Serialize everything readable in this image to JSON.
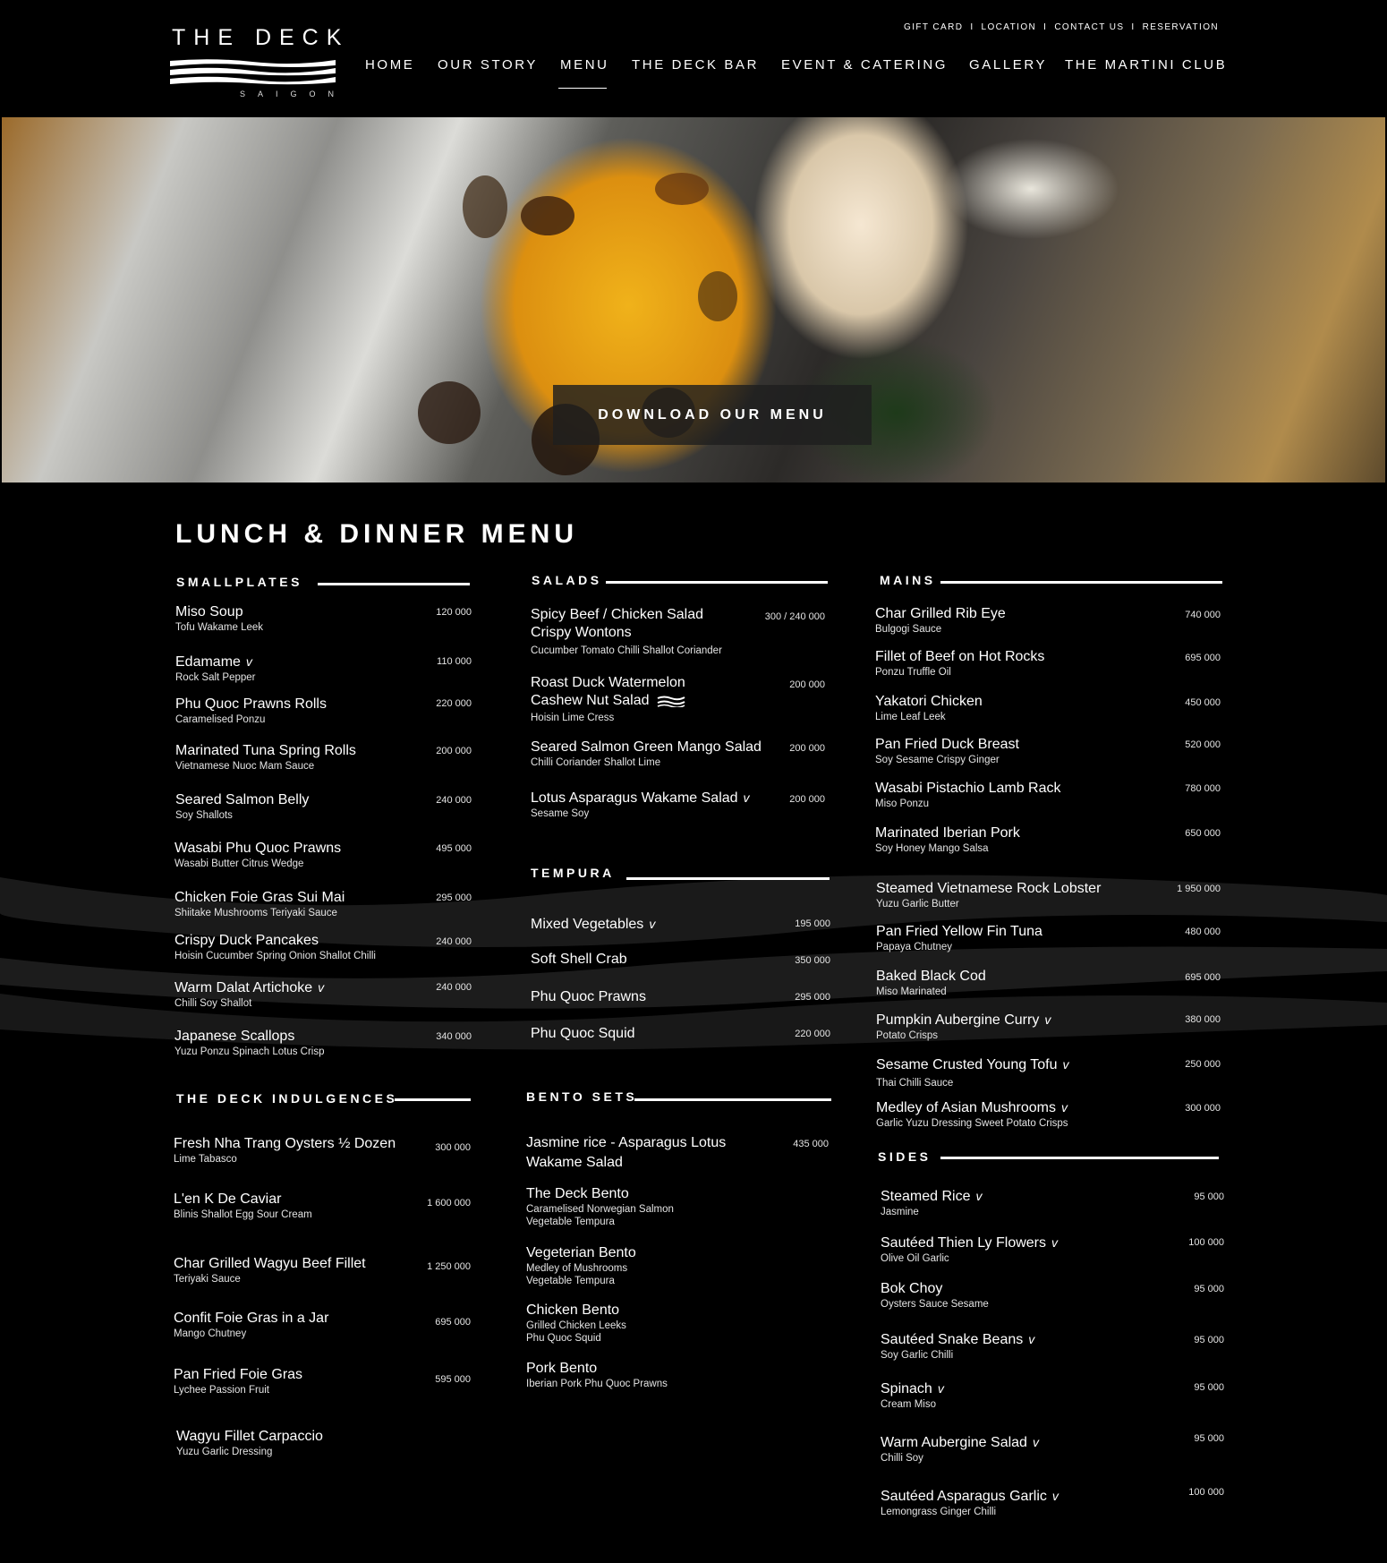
{
  "brand": {
    "title": "THE DECK",
    "subtitle": "SAIGON"
  },
  "utility_nav": [
    "GIFT CARD",
    "LOCATION",
    "CONTACT US",
    "RESERVATION"
  ],
  "utility_sep": "I",
  "main_nav": [
    "HOME",
    "OUR STORY",
    "MENU",
    "THE DECK BAR",
    "EVENT & CATERING",
    "GALLERY",
    "THE MARTINI CLUB"
  ],
  "active_nav": "MENU",
  "hero": {
    "button_label": "DOWNLOAD OUR MENU"
  },
  "page_title": "LUNCH & DINNER MENU",
  "veg_mark": "v",
  "sections": {
    "smallplates": {
      "title": "SMALLPLATES",
      "items": [
        {
          "name": "Miso Soup",
          "desc": "Tofu Wakame Leek",
          "price": "120 000"
        },
        {
          "name": "Edamame",
          "veg": true,
          "desc": "Rock Salt Pepper",
          "price": "110 000"
        },
        {
          "name": "Phu Quoc Prawns Rolls",
          "desc": "Caramelised Ponzu",
          "price": "220 000"
        },
        {
          "name": "Marinated Tuna Spring Rolls",
          "desc": "Vietnamese Nuoc Mam Sauce",
          "price": "200 000"
        },
        {
          "name": "Seared Salmon Belly",
          "desc": "Soy Shallots",
          "price": "240 000"
        },
        {
          "name": "Wasabi Phu Quoc Prawns",
          "desc": "Wasabi Butter Citrus Wedge",
          "price": "495 000"
        },
        {
          "name": "Chicken Foie Gras Sui Mai",
          "desc": "Shiitake Mushrooms Teriyaki Sauce",
          "price": "295 000"
        },
        {
          "name": "Crispy Duck Pancakes",
          "desc": "Hoisin Cucumber Spring Onion Shallot Chilli",
          "price": "240 000"
        },
        {
          "name": "Warm Dalat Artichoke",
          "veg": true,
          "desc": "Chilli Soy Shallot",
          "price": "240 000"
        },
        {
          "name": "Japanese Scallops",
          "desc": "Yuzu Ponzu Spinach Lotus Crisp",
          "price": "340 000"
        }
      ]
    },
    "indulgences": {
      "title": "THE DECK INDULGENCES",
      "items": [
        {
          "name": "Fresh Nha Trang Oysters ½ Dozen",
          "desc": "Lime Tabasco",
          "price": "300 000"
        },
        {
          "name": "L'en K De Caviar",
          "desc": "Blinis Shallot Egg Sour Cream",
          "price": "1 600 000"
        },
        {
          "name": "Char Grilled Wagyu Beef Fillet",
          "desc": "Teriyaki Sauce",
          "price": "1 250 000"
        },
        {
          "name": "Confit Foie Gras in a Jar",
          "desc": "Mango Chutney",
          "price": "695 000"
        },
        {
          "name": "Pan Fried Foie Gras",
          "desc": "Lychee Passion Fruit",
          "price": "595 000"
        },
        {
          "name": "Wagyu Fillet Carpaccio",
          "desc": "Yuzu Garlic Dressing",
          "price": ""
        }
      ]
    },
    "salads": {
      "title": "SALADS",
      "items": [
        {
          "name": "Spicy Beef / Chicken Salad",
          "name2": "Crispy Wontons",
          "desc": "Cucumber Tomato Chilli Shallot Coriander",
          "price": "300 / 240 000"
        },
        {
          "name": "Roast Duck Watermelon",
          "name2": "Cashew Nut Salad",
          "desc": "Hoisin Lime Cress",
          "price": "200 000"
        },
        {
          "name": "Seared Salmon Green Mango Salad",
          "desc": "Chilli Coriander Shallot Lime",
          "price": "200 000"
        },
        {
          "name": "Lotus Asparagus Wakame Salad",
          "veg": true,
          "desc": "Sesame Soy",
          "price": "200 000"
        }
      ]
    },
    "tempura": {
      "title": "TEMPURA",
      "items": [
        {
          "name": "Mixed Vegetables",
          "veg": true,
          "price": "195 000"
        },
        {
          "name": "Soft Shell Crab",
          "price": "350 000"
        },
        {
          "name": "Phu Quoc Prawns",
          "price": "295 000"
        },
        {
          "name": "Phu Quoc Squid",
          "price": "220 000"
        }
      ]
    },
    "bento": {
      "title": "BENTO SETS",
      "items": [
        {
          "name": "Jasmine rice  -  Asparagus Lotus",
          "name2": "Wakame Salad",
          "price": "435 000"
        },
        {
          "name": "The Deck Bento",
          "desc": "Caramelised Norwegian Salmon",
          "desc2": "Vegetable Tempura"
        },
        {
          "name": "Vegeterian Bento",
          "desc": "Medley of Mushrooms",
          "desc2": "Vegetable Tempura"
        },
        {
          "name": "Chicken Bento",
          "desc": "Grilled Chicken Leeks",
          "desc2": "Phu Quoc Squid"
        },
        {
          "name": "Pork Bento",
          "desc": "Iberian Pork Phu Quoc Prawns"
        }
      ]
    },
    "mains": {
      "title": "MAINS",
      "items": [
        {
          "name": "Char Grilled Rib Eye",
          "desc": "Bulgogi Sauce",
          "price": "740 000"
        },
        {
          "name": "Fillet of Beef on Hot Rocks",
          "desc": "Ponzu Truffle Oil",
          "price": "695 000"
        },
        {
          "name": "Yakatori Chicken",
          "desc": "Lime Leaf Leek",
          "price": "450 000"
        },
        {
          "name": "Pan Fried Duck Breast",
          "desc": "Soy Sesame Crispy Ginger",
          "price": "520 000"
        },
        {
          "name": "Wasabi Pistachio Lamb Rack",
          "desc": "Miso Ponzu",
          "price": "780 000"
        },
        {
          "name": "Marinated Iberian Pork",
          "desc": "Soy Honey Mango Salsa",
          "price": "650 000"
        },
        {
          "name": "Steamed Vietnamese Rock Lobster",
          "desc": "Yuzu Garlic Butter",
          "price": "1 950 000"
        },
        {
          "name": "Pan Fried Yellow Fin Tuna",
          "desc": "Papaya Chutney",
          "price": "480 000"
        },
        {
          "name": "Baked Black Cod",
          "desc": "Miso Marinated",
          "price": "695 000"
        },
        {
          "name": "Pumpkin Aubergine Curry",
          "veg": true,
          "desc": "Potato Crisps",
          "price": "380 000"
        },
        {
          "name": "Sesame Crusted Young Tofu",
          "veg": true,
          "desc": "Thai Chilli Sauce",
          "price": "250 000"
        },
        {
          "name": "Medley of Asian Mushrooms",
          "veg": true,
          "desc": "Garlic Yuzu Dressing Sweet Potato Crisps",
          "price": "300 000"
        }
      ]
    },
    "sides": {
      "title": "SIDES",
      "items": [
        {
          "name": "Steamed Rice",
          "veg": true,
          "desc": "Jasmine",
          "price": "95 000"
        },
        {
          "name": "Sautéed Thien Ly Flowers",
          "veg": true,
          "desc": "Olive Oil Garlic",
          "price": "100 000"
        },
        {
          "name": "Bok Choy",
          "desc": "Oysters Sauce Sesame",
          "price": "95 000"
        },
        {
          "name": "Sautéed Snake Beans",
          "veg": true,
          "desc": "Soy Garlic Chilli",
          "price": "95 000"
        },
        {
          "name": "Spinach",
          "veg": true,
          "desc": "Cream Miso",
          "price": "95 000"
        },
        {
          "name": "Warm Aubergine Salad",
          "veg": true,
          "desc": "Chilli Soy",
          "price": "95 000"
        },
        {
          "name": "Sautéed Asparagus Garlic",
          "veg": true,
          "desc": "Lemongrass Ginger Chilli",
          "price": "100 000"
        }
      ]
    }
  }
}
